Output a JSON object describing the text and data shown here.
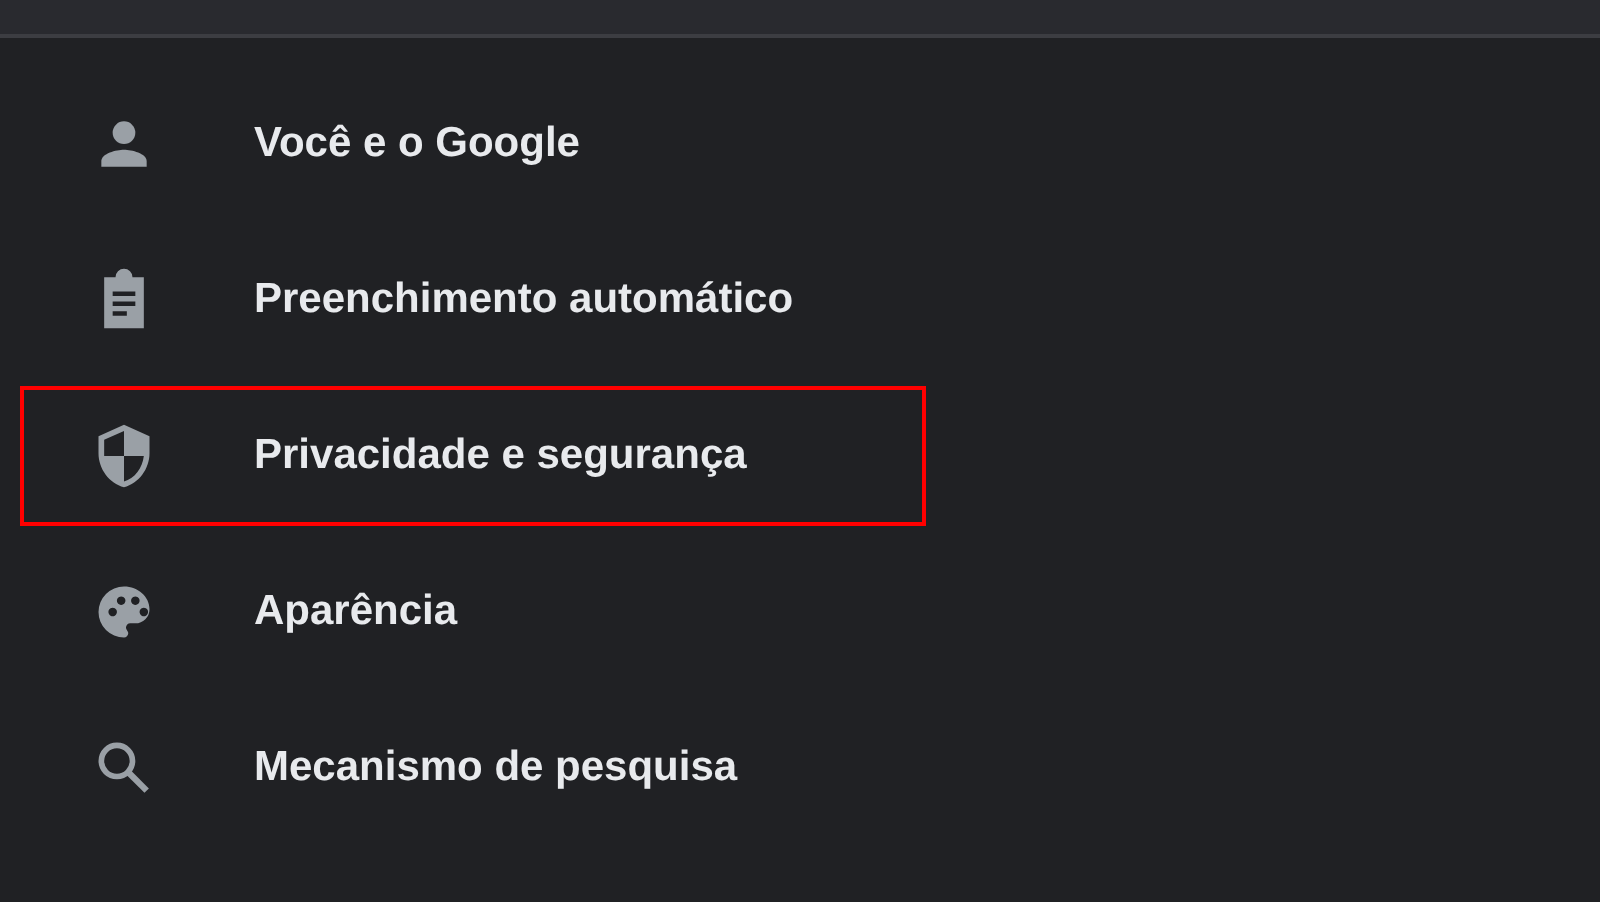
{
  "menu": {
    "items": [
      {
        "kind": "person",
        "label": "Você e o Google",
        "highlighted": false
      },
      {
        "kind": "clipboard",
        "label": "Preenchimento automático",
        "highlighted": false
      },
      {
        "kind": "shield",
        "label": "Privacidade e segurança",
        "highlighted": true
      },
      {
        "kind": "palette",
        "label": "Aparência",
        "highlighted": false
      },
      {
        "kind": "search",
        "label": "Mecanismo de pesquisa",
        "highlighted": false
      }
    ]
  }
}
